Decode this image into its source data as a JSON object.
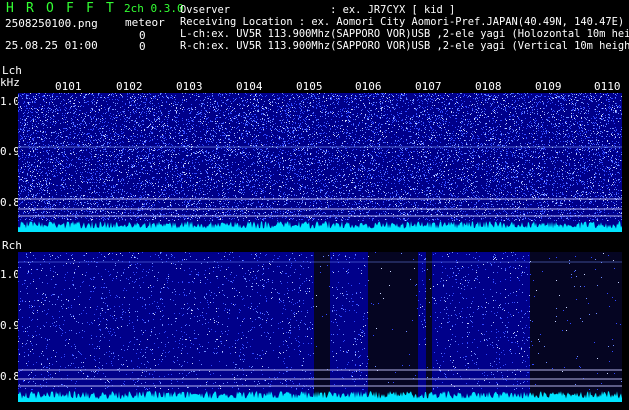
{
  "app": {
    "title_letters": [
      "H",
      "R",
      "O",
      "F",
      "F",
      "T"
    ],
    "version": "2ch 0.3.0",
    "mode": "meteor",
    "filename": "2508250100.png",
    "datetime": "25.08.25 01:00",
    "count_l": "0",
    "count_r": "0"
  },
  "info": {
    "observer": "Ovserver                : ex. JR7CYX [ kid ]",
    "location": "Receiving Location : ex. Aomori City Aomori-Pref.JAPAN(40.49N, 140.47E)",
    "lch": "L-ch:ex. UV5R 113.900Mhz(SAPPORO VOR)USB ,2-ele yagi (Holozontal 10m height)",
    "rch": "R-ch:ex. UV5R 113.900Mhz(SAPPORO VOR)USB ,2-ele yagi (Vertical 10m height)"
  },
  "lch_panel": {
    "label": "Lch",
    "unit": "kHz",
    "time_ticks": [
      "0101",
      "0102",
      "0103",
      "0104",
      "0105",
      "0106",
      "0107",
      "0108",
      "0109",
      "0110"
    ],
    "freq_labels": [
      "1.0",
      "0.9",
      "0.8"
    ]
  },
  "rch_panel": {
    "label": "Rch",
    "freq_labels": [
      "1.0",
      "0.9",
      "0.8"
    ]
  },
  "colors": {
    "background": "#000000",
    "spectrum": "#00008a",
    "trace": "#00e5ff",
    "text_green": "#33ff33"
  }
}
